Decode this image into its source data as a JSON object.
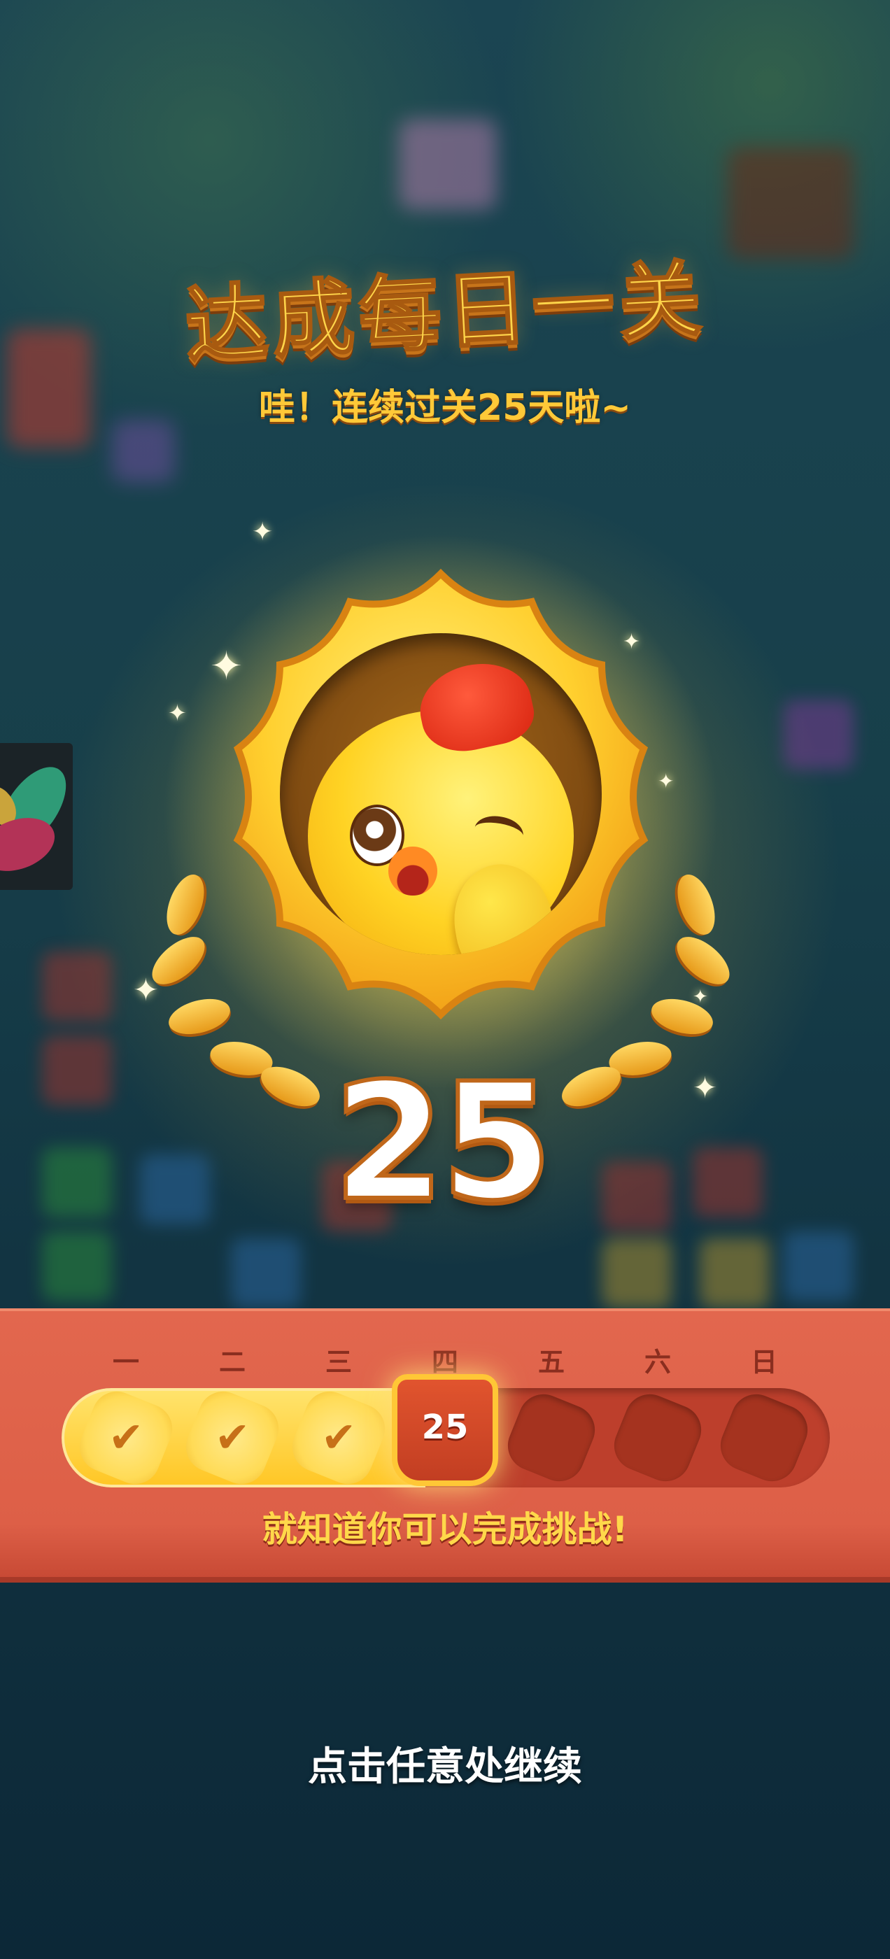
{
  "title": "达成每日一关",
  "subtitle": "哇！连续过关25天啦~",
  "badge": {
    "streak_number": "25"
  },
  "week": {
    "days": [
      "一",
      "二",
      "三",
      "四",
      "五",
      "六",
      "日"
    ],
    "completed_days": 3,
    "today_index": 3,
    "today_label": "25",
    "check_glyph": "✔",
    "message": "就知道你可以完成挑战!"
  },
  "footer": {
    "continue_text": "点击任意处继续"
  },
  "icons": [
    "chick-mascot-icon",
    "laurel-icon",
    "sparkle-icon",
    "checkmark-icon",
    "app-logo-icon"
  ],
  "colors": {
    "panel": "#dd5f47",
    "title_gold": "#ffd54a",
    "track_fill": "#ffd043"
  }
}
